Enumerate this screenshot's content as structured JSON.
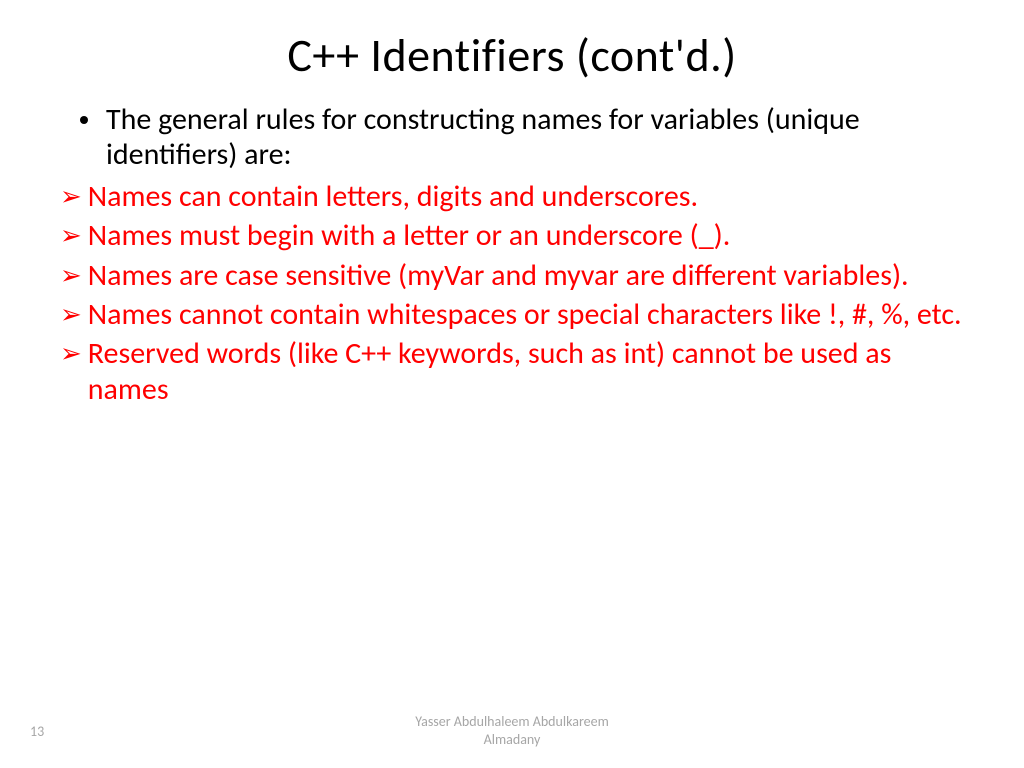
{
  "title": "C++ Identifiers (cont'd.)",
  "intro": "The general rules for constructing names for variables (unique identifiers) are:",
  "rules": [
    "Names can contain letters, digits and underscores.",
    "Names must begin with a letter or an underscore (_).",
    "Names are case sensitive (myVar and myvar are different variables).",
    "Names cannot contain whitespaces or special characters like !, #, %, etc.",
    "Reserved words (like C++ keywords, such as int) cannot be used as names"
  ],
  "footer": {
    "page": "13",
    "author_line1": "Yasser Abdulhaleem Abdulkareem",
    "author_line2": "Almadany"
  },
  "icons": {
    "arrow": "➢"
  }
}
